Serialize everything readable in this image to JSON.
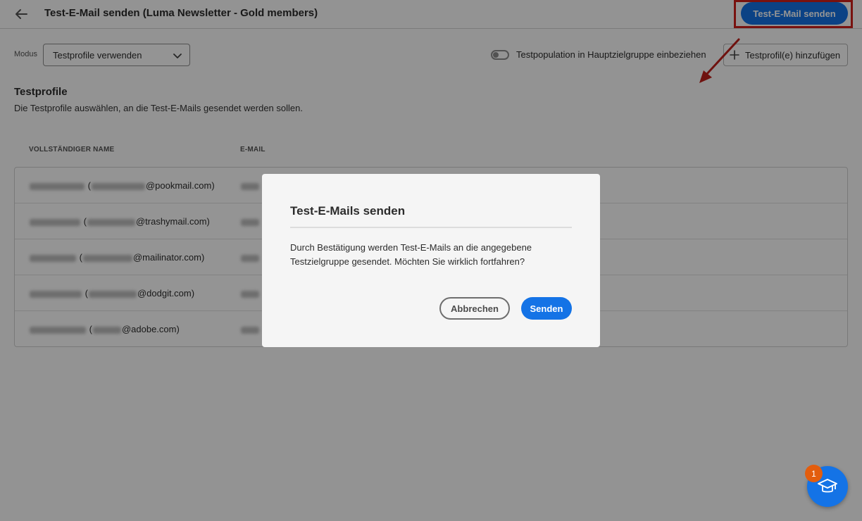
{
  "header": {
    "title": "Test-E-Mail senden (Luma Newsletter - Gold members)",
    "send_button_label": "Test-E-Mail senden"
  },
  "toolbar": {
    "mode_label": "Modus",
    "mode_value": "Testprofile verwenden",
    "toggle_label": "Testpopulation in Hauptzielgruppe einbeziehen",
    "toggle_on": false,
    "add_profile_label": "Testprofil(e) hinzufügen"
  },
  "section": {
    "title": "Testprofile",
    "description": "Die Testprofile auswählen, an die Test-E-Mails gesendet werden sollen."
  },
  "table": {
    "columns": [
      "VOLLSTÄNDIGER NAME",
      "E-MAIL"
    ],
    "rows": [
      {
        "name_suffix": "@pookmail.com)"
      },
      {
        "name_suffix": "@trashymail.com)"
      },
      {
        "name_suffix": "@mailinator.com)"
      },
      {
        "name_suffix": "@dodgit.com)"
      },
      {
        "name_suffix": "@adobe.com)"
      }
    ]
  },
  "dialog": {
    "title": "Test-E-Mails senden",
    "body": "Durch Bestätigung werden Test-E-Mails an die angegebene Testzielgruppe gesendet. Möchten Sie wirklich fortfahren?",
    "cancel_label": "Abbrechen",
    "confirm_label": "Senden"
  },
  "learn": {
    "badge_count": "1"
  },
  "colors": {
    "accent": "#1473e6",
    "highlight": "#d0201a",
    "badge": "#e35d0d"
  }
}
